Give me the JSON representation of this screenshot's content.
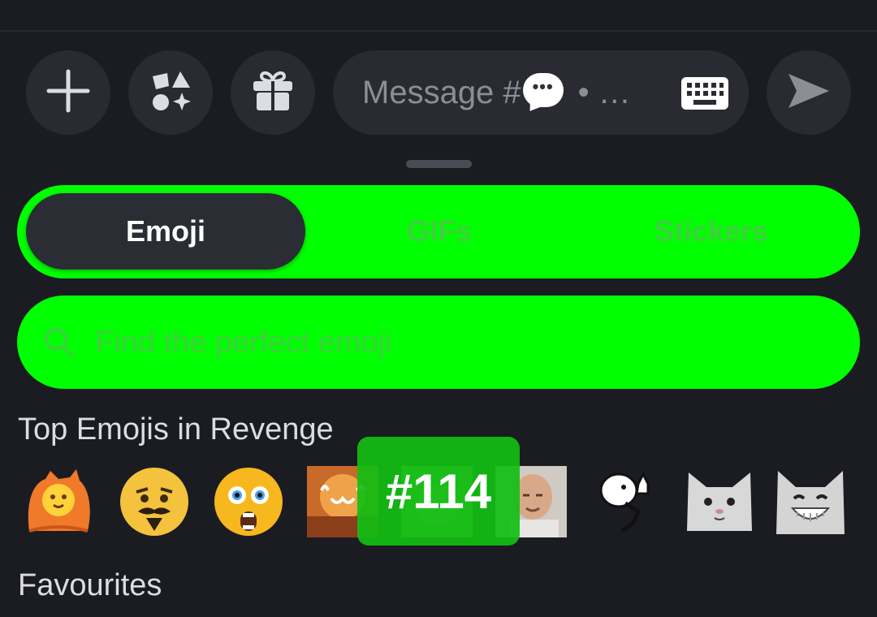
{
  "composer": {
    "message_placeholder": "Message #",
    "message_suffix": "• …"
  },
  "picker": {
    "tabs": [
      {
        "label": "Emoji",
        "active": true
      },
      {
        "label": "GIFs",
        "active": false
      },
      {
        "label": "Stickers",
        "active": false
      }
    ],
    "search_placeholder": "Find the perfect emoji",
    "sections": {
      "top_title": "Top Emojis in Revenge",
      "favourites_title": "Favourites"
    },
    "top_emojis": [
      {
        "icon": "orange-cat-emoji"
      },
      {
        "icon": "mustache-pleading-emoji"
      },
      {
        "icon": "screaming-face-emoji"
      },
      {
        "icon": "explosion-cat-face-emoji"
      },
      {
        "icon": "green-blurred-emoji"
      },
      {
        "icon": "bald-man-photo-emoji"
      },
      {
        "icon": "thumbs-up-stick-figure-emoji"
      },
      {
        "icon": "white-cat-emoji"
      },
      {
        "icon": "grinning-white-cat-emoji"
      }
    ]
  },
  "overlay": {
    "badge_label": "#114"
  },
  "colors": {
    "background": "#1b1c22",
    "highlight": "#00ff00",
    "button": "#2a2b32"
  }
}
